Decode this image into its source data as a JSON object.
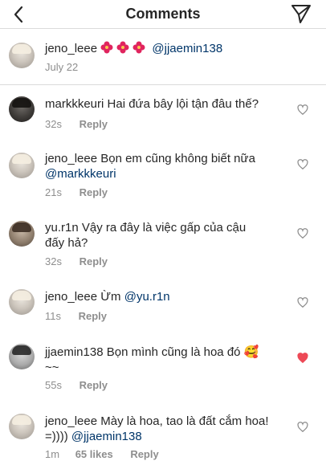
{
  "header": {
    "title": "Comments"
  },
  "caption": {
    "username": "jeno_leee",
    "mention": "@jjaemin138",
    "date": "July 22",
    "flower_emoji": "🌺🌺🌺"
  },
  "comments": [
    {
      "username": "markkkeuri",
      "text_line1": "Hai đứa bây lội tận đâu thế?",
      "text_line2": "",
      "time": "32s",
      "reply_label": "Reply",
      "liked": false
    },
    {
      "username": "jeno_leee",
      "text_line1": "Bọn em cũng không biết nữa",
      "mention_line2": "@markkkeuri",
      "time": "21s",
      "reply_label": "Reply",
      "liked": false
    },
    {
      "username": "yu.r1n",
      "text_line1": "Vậy ra đây là việc gấp của cậu",
      "text_line2": "đấy hả?",
      "time": "32s",
      "reply_label": "Reply",
      "liked": false
    },
    {
      "username": "jeno_leee",
      "text_line1": "Ừm",
      "mention_line1": "@yu.r1n",
      "time": "11s",
      "reply_label": "Reply",
      "liked": false
    },
    {
      "username": "jjaemin138",
      "text_line1": "Bọn mình cũng là hoa đó",
      "text_line2": "~~",
      "emoji": "🥰",
      "time": "55s",
      "reply_label": "Reply",
      "liked": true
    },
    {
      "username": "jeno_leee",
      "text_line1": "Mày là hoa, tao là đất cắm hoa!",
      "text_line2": "=))))",
      "mention_line2": "@jjaemin138",
      "time": "1m",
      "likes_label": "65 likes",
      "reply_label": "Reply",
      "liked": false
    }
  ],
  "colors": {
    "text": "#262626",
    "muted": "#8e8e8e",
    "mention": "#003569",
    "liked_heart": "#ed4956",
    "divider": "#dbdbdb"
  },
  "icons": {
    "back": "chevron-left-icon",
    "send": "paper-plane-icon",
    "heart": "heart-icon"
  }
}
